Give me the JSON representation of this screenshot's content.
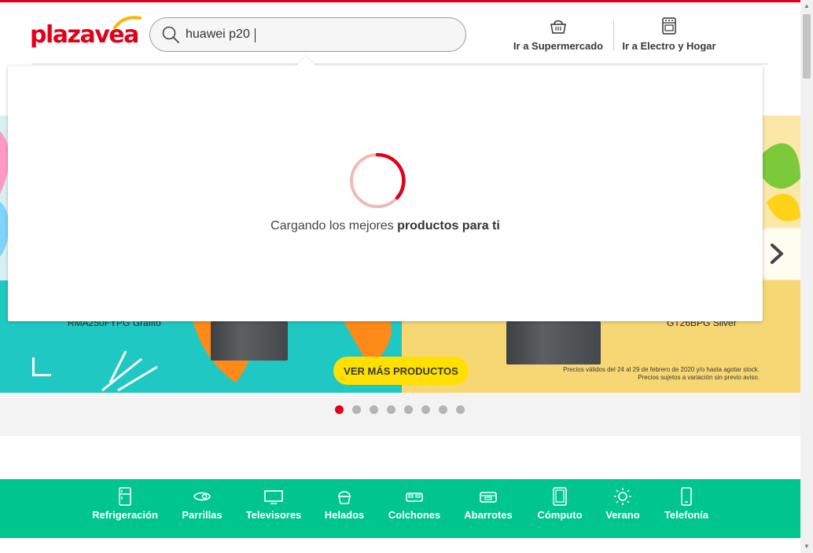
{
  "brand": {
    "logo_text": "plazavea",
    "accent_color": "#e1001a"
  },
  "search": {
    "value": "huawei p20",
    "placeholder": ""
  },
  "nav": {
    "supermercado": "Ir a Supermercado",
    "electro_hogar": "Ir a Electro y Hogar"
  },
  "loading_panel": {
    "text_regular": "Cargando los mejores ",
    "text_bold": "productos para ti"
  },
  "hero": {
    "model_left": "RMA250FYPG Grafito",
    "model_right": "GT26BPG Silver",
    "cta": "VER MÁS PRODUCTOS",
    "legal_line1": "Precios válidos del 24 al 29 de febrero de 2020 y/o hasta agotar stock.",
    "legal_line2": "Precios sujetos a variación sin previo aviso."
  },
  "carousel": {
    "total_slides": 8,
    "active_index": 0
  },
  "categories": [
    {
      "label": "Refrigeración",
      "icon": "fridge-icon"
    },
    {
      "label": "Parrillas",
      "icon": "grill-icon"
    },
    {
      "label": "Televisores",
      "icon": "tv-icon"
    },
    {
      "label": "Helados",
      "icon": "ice-cream-icon"
    },
    {
      "label": "Colchones",
      "icon": "bed-icon"
    },
    {
      "label": "Abarrotes",
      "icon": "groceries-icon"
    },
    {
      "label": "Cómputo",
      "icon": "tablet-icon"
    },
    {
      "label": "Verano",
      "icon": "sun-icon"
    },
    {
      "label": "Telefonía",
      "icon": "phone-icon"
    }
  ],
  "colors": {
    "category_bar": "#00c58e",
    "cta_yellow": "#ffe000",
    "hero_teal": "#1fc8c3"
  }
}
